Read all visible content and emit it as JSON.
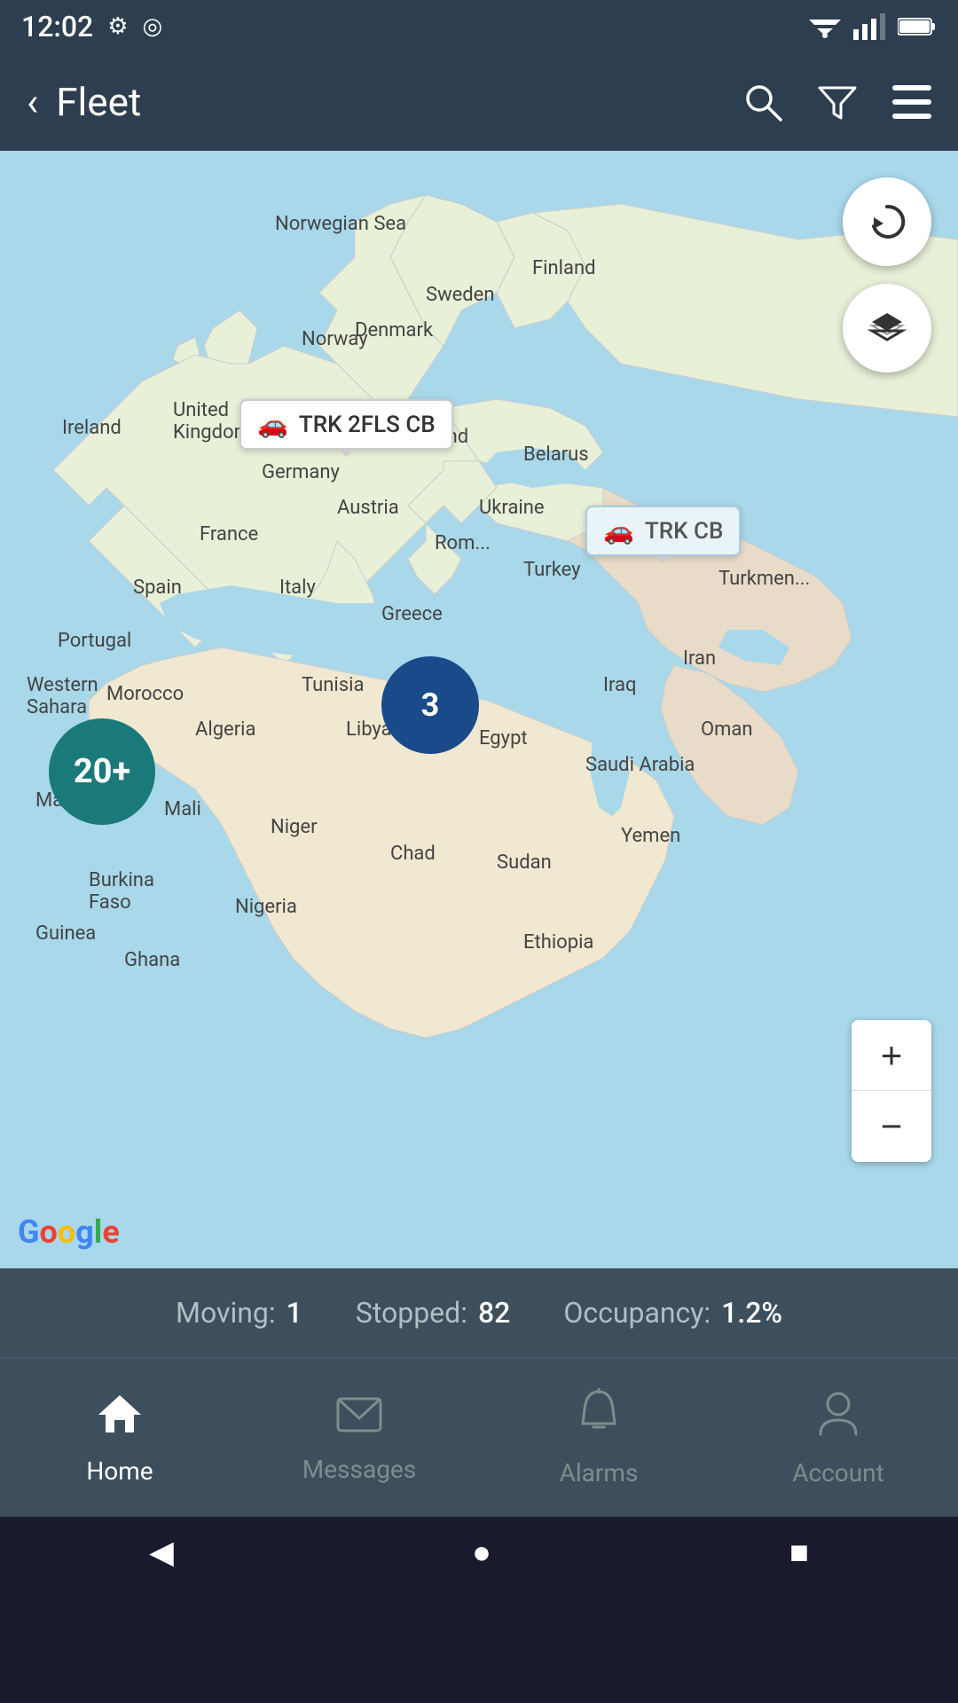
{
  "statusBar": {
    "time": "12:02",
    "icons": [
      "⚙",
      "◎"
    ]
  },
  "navBar": {
    "title": "Fleet",
    "backArrow": "‹",
    "searchLabel": "search",
    "filterLabel": "filter",
    "menuLabel": "menu"
  },
  "map": {
    "refreshButtonLabel": "refresh",
    "layersButtonLabel": "layers",
    "zoomInLabel": "+",
    "zoomOutLabel": "−",
    "googleLogo": "Google",
    "vehicles": [
      {
        "id": "trk-2fls-cb",
        "label": "TRK 2FLS CB",
        "type": "moving"
      },
      {
        "id": "trk-cb",
        "label": "TRK CB",
        "type": "stopped"
      }
    ],
    "clusters": [
      {
        "id": "cluster-20plus",
        "count": "20+",
        "size": "large"
      },
      {
        "id": "cluster-3",
        "count": "3",
        "size": "medium"
      }
    ],
    "countryLabels": [
      "Norwegian Sea",
      "Sweden",
      "Finland",
      "Norway",
      "United Kingdom",
      "Ireland",
      "Denmark",
      "Belarus",
      "Poland",
      "Germany",
      "Ukraine",
      "France",
      "Austria",
      "Romania",
      "Italy",
      "Spain",
      "Portugal",
      "Greece",
      "Turkey",
      "Turkmenistan",
      "Morocco",
      "Algeria",
      "Tunisia",
      "Libya",
      "Egypt",
      "Western Sahara",
      "Mauritania",
      "Mali",
      "Burkina Faso",
      "Guinea",
      "Ghana",
      "Niger",
      "Chad",
      "Nigeria",
      "Sudan",
      "Ethiopia",
      "Saudi Arabia",
      "Yemen",
      "Iraq",
      "Iran",
      "Oman"
    ]
  },
  "statusStrip": {
    "movingLabel": "Moving:",
    "movingValue": "1",
    "stoppedLabel": "Stopped:",
    "stoppedValue": "82",
    "occupancyLabel": "Occupancy:",
    "occupancyValue": "1.2%"
  },
  "bottomNav": {
    "items": [
      {
        "id": "home",
        "label": "Home",
        "icon": "⌂",
        "active": true
      },
      {
        "id": "messages",
        "label": "Messages",
        "icon": "✉",
        "active": false
      },
      {
        "id": "alarms",
        "label": "Alarms",
        "icon": "🔔",
        "active": false
      },
      {
        "id": "account",
        "label": "Account",
        "icon": "👤",
        "active": false
      }
    ]
  },
  "systemNav": {
    "backLabel": "◀",
    "homeLabel": "●",
    "recentLabel": "■"
  }
}
